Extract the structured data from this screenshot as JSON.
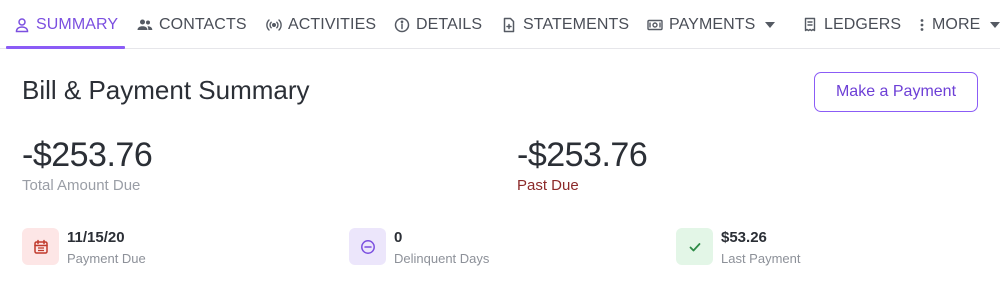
{
  "tabs": [
    {
      "key": "summary",
      "label": "SUMMARY",
      "icon": "person-icon",
      "active": true
    },
    {
      "key": "contacts",
      "label": "CONTACTS",
      "icon": "people-icon"
    },
    {
      "key": "activities",
      "label": "ACTIVITIES",
      "icon": "broadcast-icon"
    },
    {
      "key": "details",
      "label": "DETAILS",
      "icon": "info-icon"
    },
    {
      "key": "statements",
      "label": "STATEMENTS",
      "icon": "document-icon"
    },
    {
      "key": "payments",
      "label": "PAYMENTS",
      "icon": "money-icon",
      "dropdown": true
    },
    {
      "key": "ledgers",
      "label": "LEDGERS",
      "icon": "receipt-icon"
    },
    {
      "key": "more",
      "label": "MORE",
      "icon": "kebab-icon",
      "dropdown": true
    }
  ],
  "header": {
    "title": "Bill & Payment Summary",
    "action_label": "Make a Payment"
  },
  "amounts": {
    "total": {
      "value": "-$253.76",
      "label": "Total Amount Due"
    },
    "past_due": {
      "value": "-$253.76",
      "label": "Past Due"
    }
  },
  "stats": {
    "payment_due": {
      "value": "11/15/20",
      "label": "Payment Due",
      "icon": "calendar-icon"
    },
    "delinquent": {
      "value": "0",
      "label": "Delinquent Days",
      "icon": "minus-circle-icon"
    },
    "last_payment": {
      "value": "$53.26",
      "label": "Last Payment",
      "icon": "check-icon"
    }
  },
  "colors": {
    "accent": "#8b5cf6",
    "past_due_red": "#8c2a2a",
    "badge_red_bg": "#fde6e6",
    "badge_purple_bg": "#ece6fb",
    "badge_green_bg": "#e3f6e7"
  }
}
